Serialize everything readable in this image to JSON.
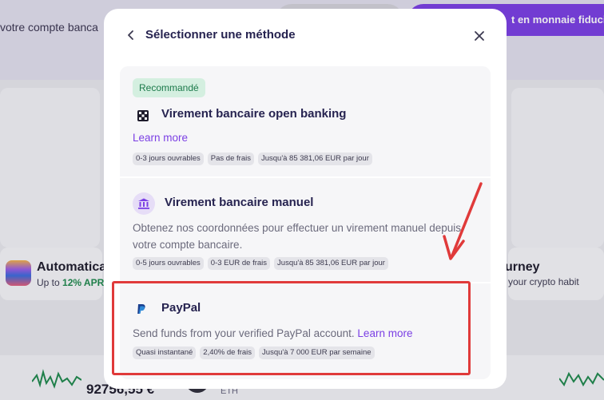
{
  "background": {
    "header_text": "votre compte banca",
    "header_button": "t en monnaie fiduci",
    "promo_left": {
      "title": "Automatica",
      "sub_prefix": "Up to ",
      "sub_highlight": "12% APR",
      "sub_suffix": " o"
    },
    "promo_right": {
      "title": "urney",
      "sub": "your crypto habit"
    },
    "price": "92756,55 €",
    "asset": "ETH"
  },
  "modal": {
    "title": "Sélectionner une méthode",
    "back_icon": "chevron-left-icon",
    "close_icon": "close-icon"
  },
  "methods": [
    {
      "badge": "Recommandé",
      "icon": "open-banking-icon",
      "title": "Virement bancaire open banking",
      "link": "Learn more",
      "chips": [
        "0-3 jours ouvrables",
        "Pas de frais",
        "Jusqu'à 85 381,06 EUR par jour"
      ]
    },
    {
      "icon": "bank-icon",
      "title": "Virement bancaire manuel",
      "desc": "Obtenez nos coordonnées pour effectuer un virement manuel depuis votre compte bancaire.",
      "chips": [
        "0-5 jours ouvrables",
        "0-3 EUR de frais",
        "Jusqu'à 85 381,06 EUR par jour"
      ]
    },
    {
      "icon": "paypal-icon",
      "title": "PayPal",
      "desc": "Send funds from your verified PayPal account.",
      "link": "Learn more",
      "chips": [
        "Quasi instantané",
        "2,40% de frais",
        "Jusqu'à 7 000 EUR par semaine"
      ]
    }
  ],
  "colors": {
    "accent": "#7b3fe4",
    "annotation": "#e03a3a",
    "badge_bg": "#d4efe0",
    "badge_text": "#1c7a4b"
  }
}
